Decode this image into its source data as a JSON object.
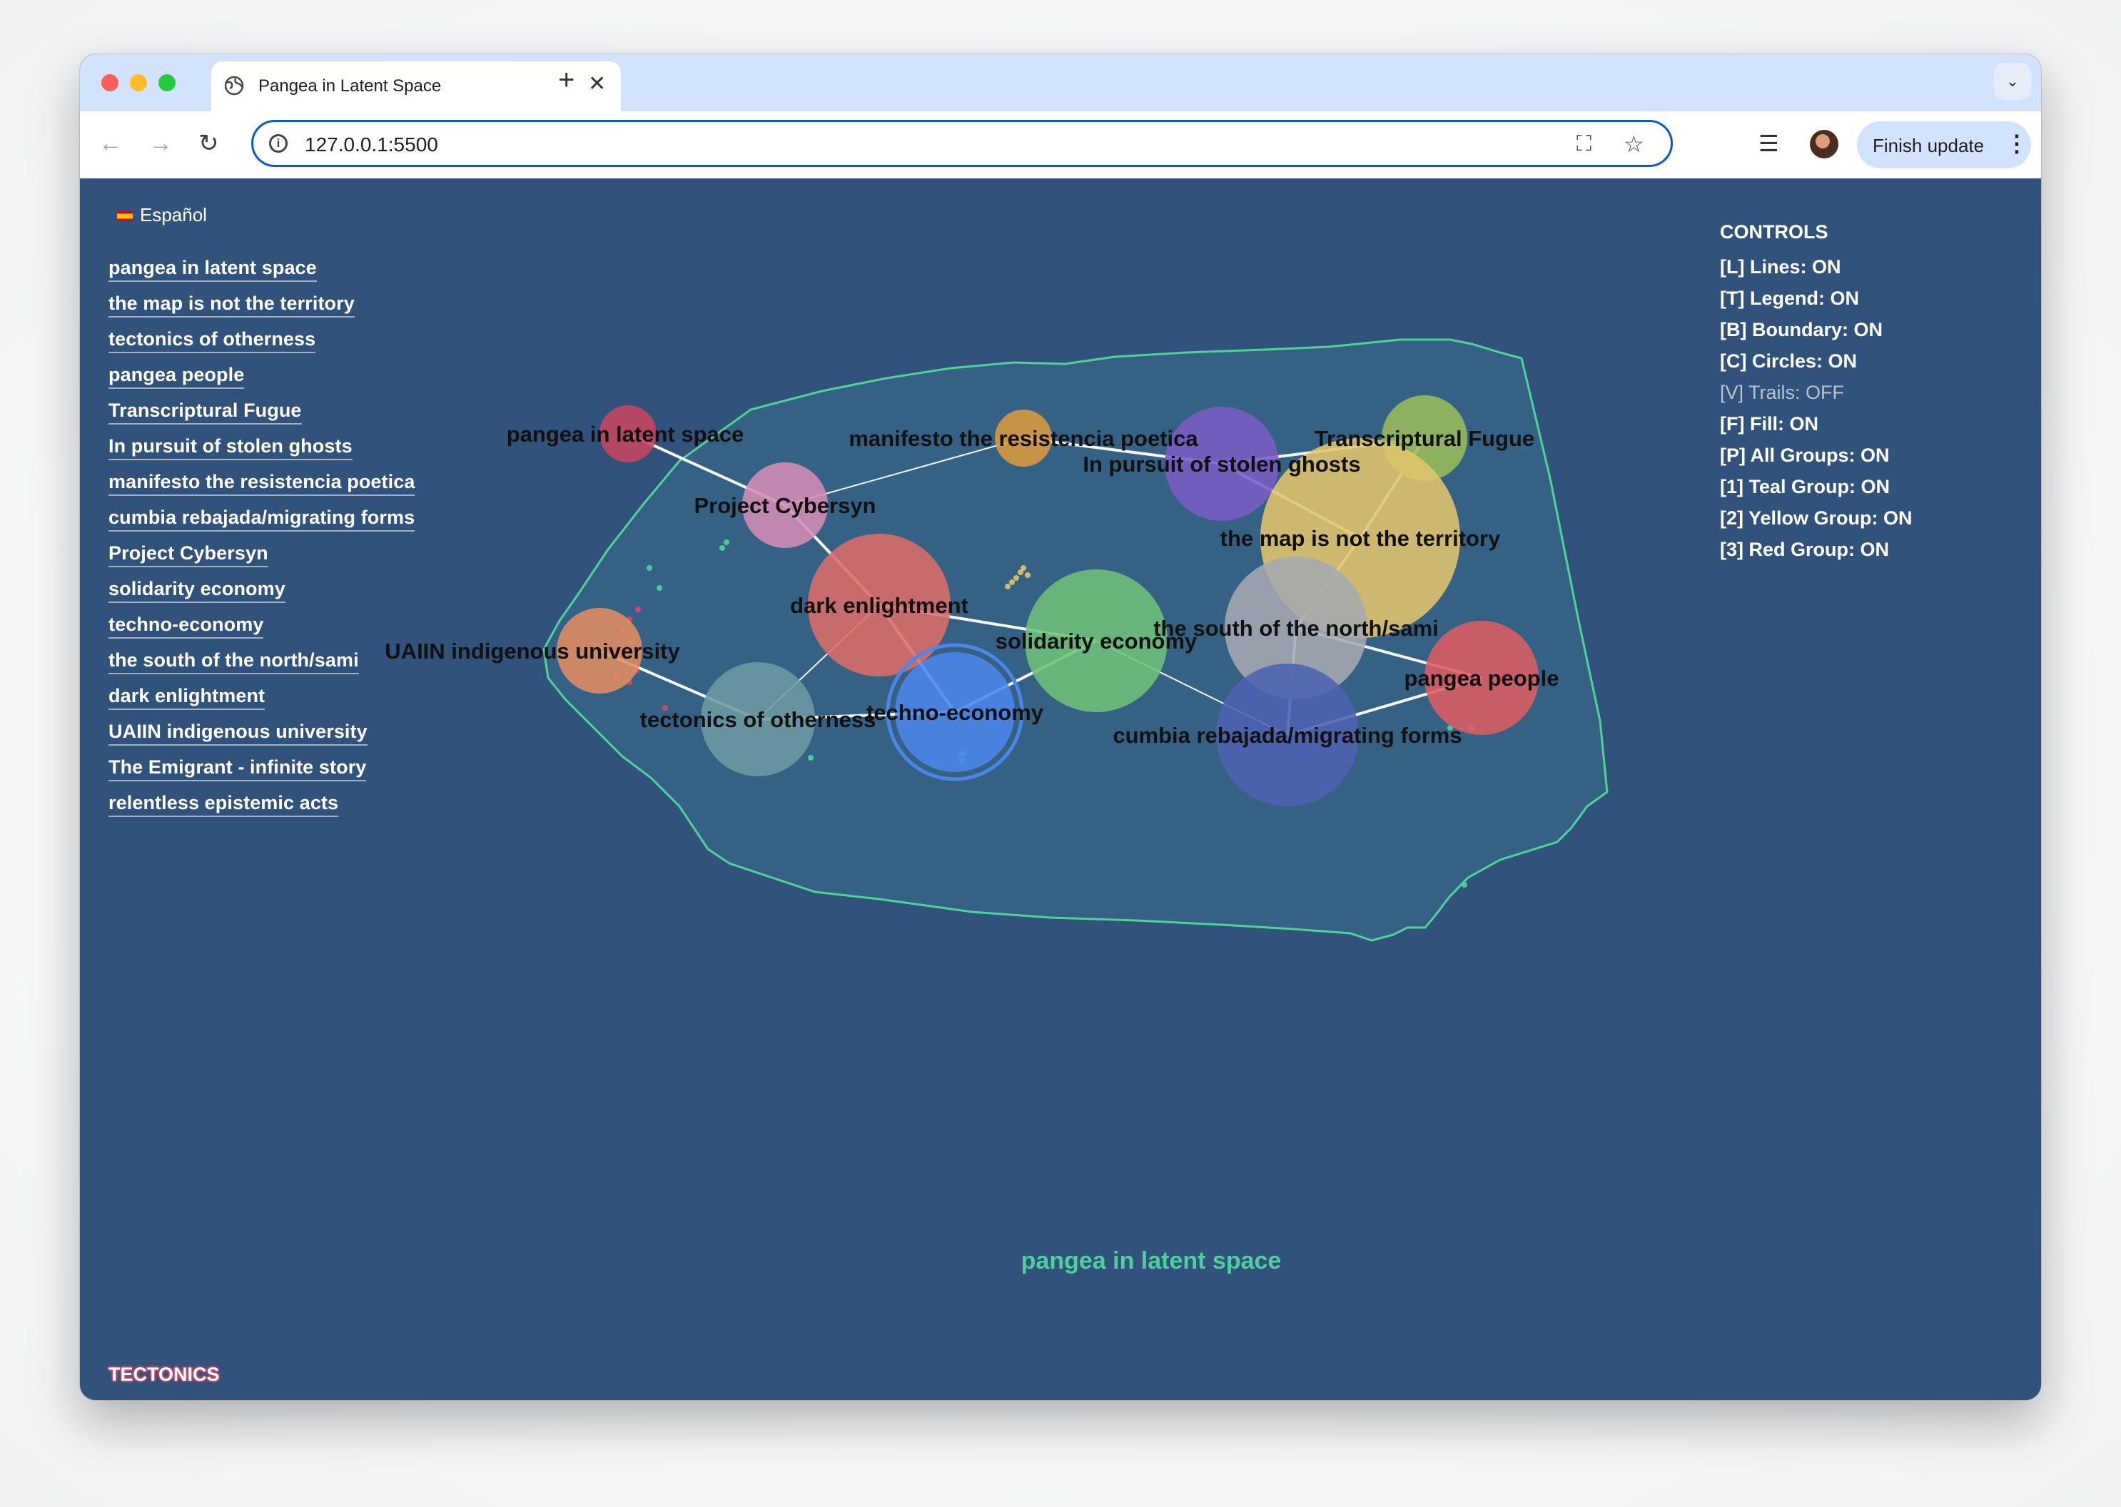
{
  "browser": {
    "tab_title": "Pangea in Latent Space",
    "url": "127.0.0.1:5500",
    "update_button": "Finish update"
  },
  "page": {
    "language_toggle": "Español",
    "nav_links": [
      "pangea in latent space",
      "the map is not the territory",
      "tectonics of otherness",
      "pangea people",
      "Transcriptural Fugue",
      "In pursuit of stolen ghosts",
      "manifesto the resistencia poetica",
      "cumbia rebajada/migrating forms",
      "Project Cybersyn",
      "solidarity economy",
      "techno-economy",
      "the south of the north/sami",
      "dark enlightment",
      "UAIIN indigenous university",
      "The Emigrant - infinite story",
      "relentless epistemic acts"
    ],
    "controls_title": "CONTROLS",
    "controls": [
      {
        "text": "[L] Lines: ON",
        "on": true
      },
      {
        "text": "[T] Legend: ON",
        "on": true
      },
      {
        "text": "[B] Boundary: ON",
        "on": true
      },
      {
        "text": "[C] Circles: ON",
        "on": true
      },
      {
        "text": "[V] Trails: OFF",
        "on": false
      },
      {
        "text": "[F] Fill: ON",
        "on": true
      },
      {
        "text": "[P] All Groups: ON",
        "on": true
      },
      {
        "text": "[1] Teal Group: ON",
        "on": true
      },
      {
        "text": "[2] Yellow Group: ON",
        "on": true
      },
      {
        "text": "[3] Red Group: ON",
        "on": true
      }
    ],
    "caption": "pangea in latent space",
    "tectonics_label": "TECTONICS",
    "tectonics_value": 0
  },
  "graph": {
    "colors": {
      "boundary": "#4fd39a",
      "link": "#ffffff"
    },
    "nodes": [
      {
        "label": "pangea in latent space",
        "color": "#c84560"
      },
      {
        "label": "manifesto the resistencia poetica",
        "color": "#dc9a3e"
      },
      {
        "label": "Transcriptural Fugue",
        "color": "#9bbc5a"
      },
      {
        "label": "In pursuit of stolen ghosts",
        "color": "#7a5cc4"
      },
      {
        "label": "Project Cybersyn",
        "color": "#d48cb5"
      },
      {
        "label": "the map is not the territory",
        "color": "#e2c46c"
      },
      {
        "label": "dark enlightment",
        "color": "#dc6c6a"
      },
      {
        "label": "solidarity economy",
        "color": "#6fc07a"
      },
      {
        "label": "the south of the north/sami",
        "color": "#a6aab0"
      },
      {
        "label": "UAIIN indigenous university",
        "color": "#e18c62"
      },
      {
        "label": "pangea people",
        "color": "#dc5c62"
      },
      {
        "label": "tectonics of otherness",
        "color": "#6d9aa0"
      },
      {
        "label": "techno-economy",
        "color": "#4c86ea"
      },
      {
        "label": "cumbia rebajada/migrating forms",
        "color": "#4c62b0"
      }
    ]
  }
}
